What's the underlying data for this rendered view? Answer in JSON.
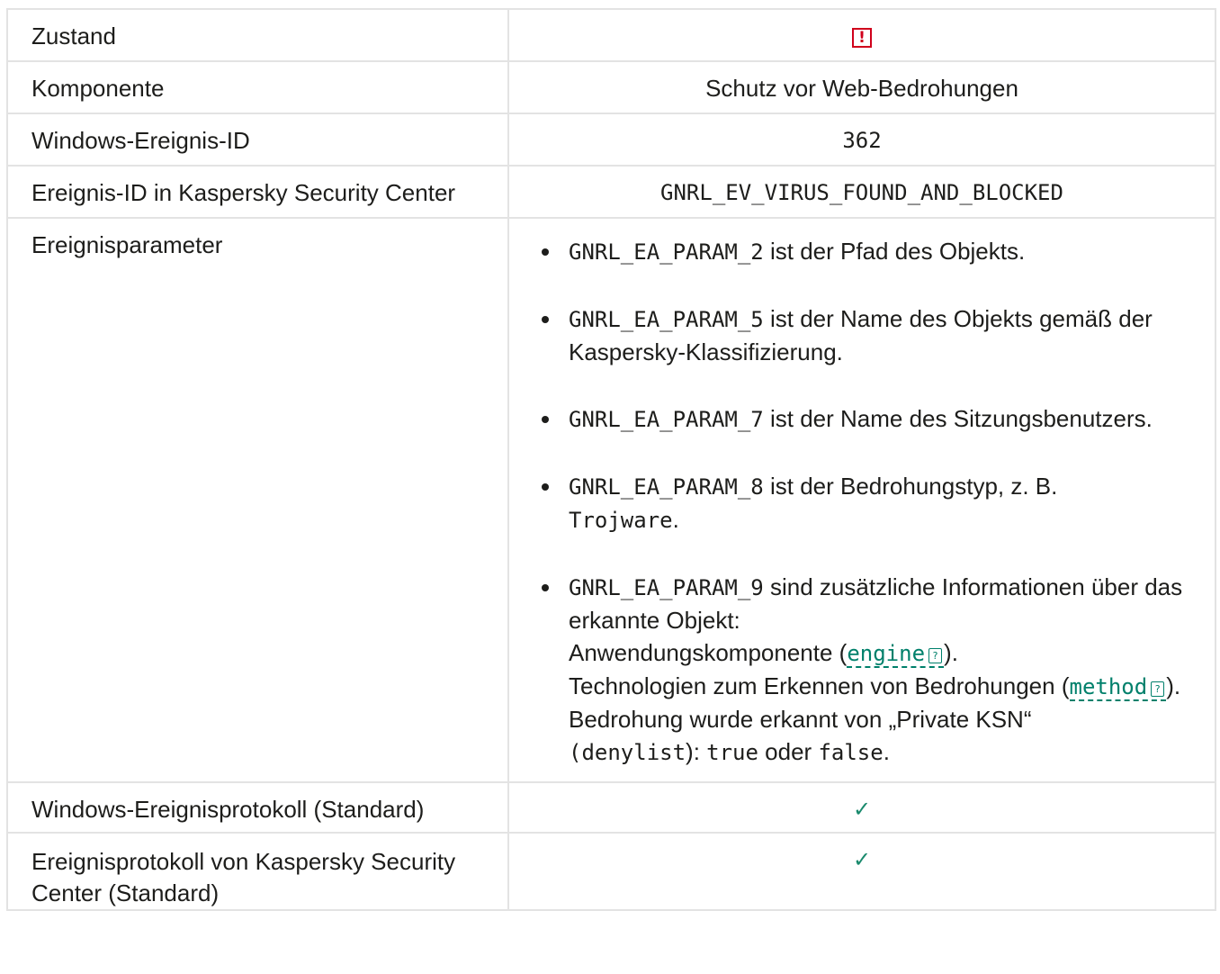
{
  "rows": {
    "state": {
      "label": "Zustand",
      "value_icon": "warning-icon",
      "icon_glyph": "!"
    },
    "component": {
      "label": "Komponente",
      "value": "Schutz vor Web-Bedrohungen"
    },
    "windows_id": {
      "label": "Windows-Ereignis-ID",
      "value": "362"
    },
    "ksc_id": {
      "label": "Ereignis-ID in Kaspersky Security Center",
      "value": "GNRL_EV_VIRUS_FOUND_AND_BLOCKED"
    },
    "params": {
      "label": "Ereignisparameter",
      "items": [
        {
          "code": "GNRL_EA_PARAM_2",
          "text": " ist der Pfad des Objekts."
        },
        {
          "code": "GNRL_EA_PARAM_5",
          "text": " ist der Name des Objekts gemäß der Kaspersky-Klassifizierung."
        },
        {
          "code": "GNRL_EA_PARAM_7",
          "text": " ist der Name des Sitzungsbenutzers."
        },
        {
          "code": "GNRL_EA_PARAM_8",
          "text": " ist der Bedrohungstyp, z. B. ",
          "code2": "Trojware",
          "tail": "."
        },
        {
          "code": "GNRL_EA_PARAM_9",
          "text": " sind zusätzliche Informationen über das erkannte Objekt:",
          "l1_pre": "Anwendungskomponente (",
          "l1_link": "engine",
          "l1_post": ").",
          "l2_pre": "Technologien zum Erkennen von Bedrohungen (",
          "l2_link": "method",
          "l2_post": ").",
          "l3": "Bedrohung wurde erkannt von „Private KSN“",
          "l4_open": "(",
          "l4_code": "denylist",
          "l4_mid": "): ",
          "l4_true": "true",
          "l4_or": " oder ",
          "l4_false": "false",
          "l4_end": "."
        }
      ]
    },
    "win_log": {
      "label": "Windows-Ereignisprotokoll (Standard)",
      "value": "✓"
    },
    "ksc_log": {
      "label": "Ereignisprotokoll von Kaspersky Security Center (Standard)",
      "value": "✓"
    }
  },
  "hint_glyph": "?",
  "colors": {
    "accent": "#00806b",
    "warning": "#d0001b",
    "check": "#1a8a6d"
  }
}
